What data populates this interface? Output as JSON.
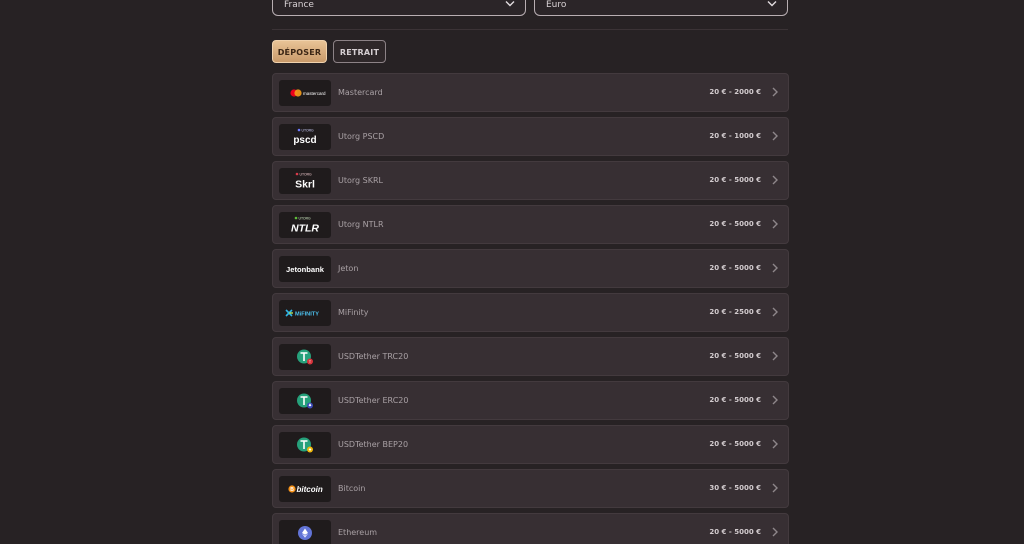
{
  "filters": {
    "country": "France",
    "currency": "Euro"
  },
  "tabs": {
    "deposit": "DÉPOSER",
    "withdraw": "RETRAIT"
  },
  "methods": [
    {
      "id": "mastercard",
      "name": "Mastercard",
      "range": "20 € - 2000 €",
      "logo_text": "mastercard",
      "logo_sub": ""
    },
    {
      "id": "pscd",
      "name": "Utorg PSCD",
      "range": "20 € - 1000 €",
      "logo_text": "pscd",
      "logo_sub": "UTORG"
    },
    {
      "id": "skrl",
      "name": "Utorg SKRL",
      "range": "20 € - 5000 €",
      "logo_text": "Skrl",
      "logo_sub": "UTORG"
    },
    {
      "id": "ntlr",
      "name": "Utorg NTLR",
      "range": "20 € - 5000 €",
      "logo_text": "NTLR",
      "logo_sub": "UTORG"
    },
    {
      "id": "jeton",
      "name": "Jeton",
      "range": "20 € - 5000 €",
      "logo_text": "Jetonbank",
      "logo_sub": ""
    },
    {
      "id": "mifinity",
      "name": "MiFinity",
      "range": "20 € - 2500 €",
      "logo_text": "MiFINITY",
      "logo_sub": ""
    },
    {
      "id": "usdt-trc20",
      "name": "USDTether TRC20",
      "range": "20 € - 5000 €",
      "logo_text": "",
      "logo_sub": ""
    },
    {
      "id": "usdt-erc20",
      "name": "USDTether ERC20",
      "range": "20 € - 5000 €",
      "logo_text": "",
      "logo_sub": ""
    },
    {
      "id": "usdt-bep20",
      "name": "USDTether BEP20",
      "range": "20 € - 5000 €",
      "logo_text": "",
      "logo_sub": ""
    },
    {
      "id": "bitcoin",
      "name": "Bitcoin",
      "range": "30 € - 5000 €",
      "logo_text": "bitcoin",
      "logo_sub": ""
    },
    {
      "id": "ethereum",
      "name": "Ethereum",
      "range": "20 € - 5000 €",
      "logo_text": "",
      "logo_sub": ""
    }
  ],
  "colors": {
    "background": "#272224",
    "card": "#372f33",
    "accent": "#e0b88a",
    "tether": "#26a17b"
  }
}
